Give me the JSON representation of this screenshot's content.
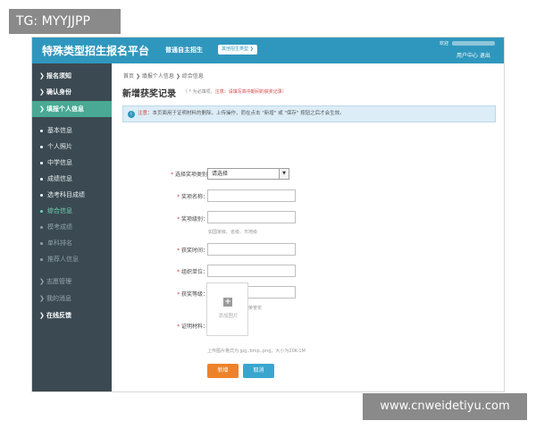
{
  "watermark_top": "TG: MYYJJPP",
  "watermark_bottom": "www.cnweidetiyu.com",
  "header": {
    "title": "特殊类型招生报名平台",
    "subtitle": "普通自主招生",
    "type_button": "其他招生类型 ❯",
    "user_prefix": "欢迎",
    "links": "用户中心  退出"
  },
  "sidebar": {
    "items": [
      {
        "label": "报名须知",
        "chevron": "❯"
      },
      {
        "label": "确认身份",
        "chevron": "❯"
      },
      {
        "label": "填报个人信息",
        "chevron": "❯"
      }
    ],
    "sub_items": [
      {
        "label": "基本信息"
      },
      {
        "label": "个人照片"
      },
      {
        "label": "中学信息"
      },
      {
        "label": "成绩信息"
      },
      {
        "label": "选考科目成绩"
      },
      {
        "label": "综合信息"
      },
      {
        "label": "模考成绩"
      },
      {
        "label": "单科排名"
      },
      {
        "label": "推荐人信息"
      }
    ],
    "bottom_items": [
      {
        "label": "志愿管理",
        "chevron": "❯"
      },
      {
        "label": "我的消息",
        "chevron": "❯"
      },
      {
        "label": "在线反馈",
        "chevron": "❯"
      }
    ]
  },
  "breadcrumb": {
    "home": "首页",
    "sep": "❯",
    "level2": "填报个人信息",
    "level3": "综合信息"
  },
  "page": {
    "title": "新增获奖记录",
    "note_prefix": "（ * 为必填项，",
    "note_warn": "注意：请填写高中期间的获奖记录",
    "note_suffix": "）"
  },
  "notice": {
    "icon": "i",
    "prefix": "注意：",
    "text": "本页面用于证明材料的删除，上传操作，而在点击 \"新增\" 或 \"保存\" 按钮之后才会生效。"
  },
  "form": {
    "award_type_label": "选择奖项类别：",
    "award_type_value": "请选择",
    "award_name_label": "奖项名称：",
    "award_level_label": "奖项级别：",
    "award_level_hint": "如国家级、省级、市地级",
    "award_time_label": "获奖时间：",
    "organizer_label": "组织单位：",
    "award_grade_label": "获奖等级：",
    "award_grade_hint": "如一等奖、二等奖、荣誉奖",
    "proof_label": "证明材料：",
    "upload_caption": "添加图片",
    "upload_hint": "上传图片格式为.jpg,.bmp,.png；大小为20K-1M",
    "star": "*"
  },
  "buttons": {
    "add": "新增",
    "cancel": "取消"
  },
  "colors": {
    "header_blue": "#2f97bd",
    "sidebar_dark": "#3b4a52",
    "sidebar_active": "#49a994",
    "add_orange": "#ee8229",
    "cancel_blue": "#39a6cf"
  }
}
